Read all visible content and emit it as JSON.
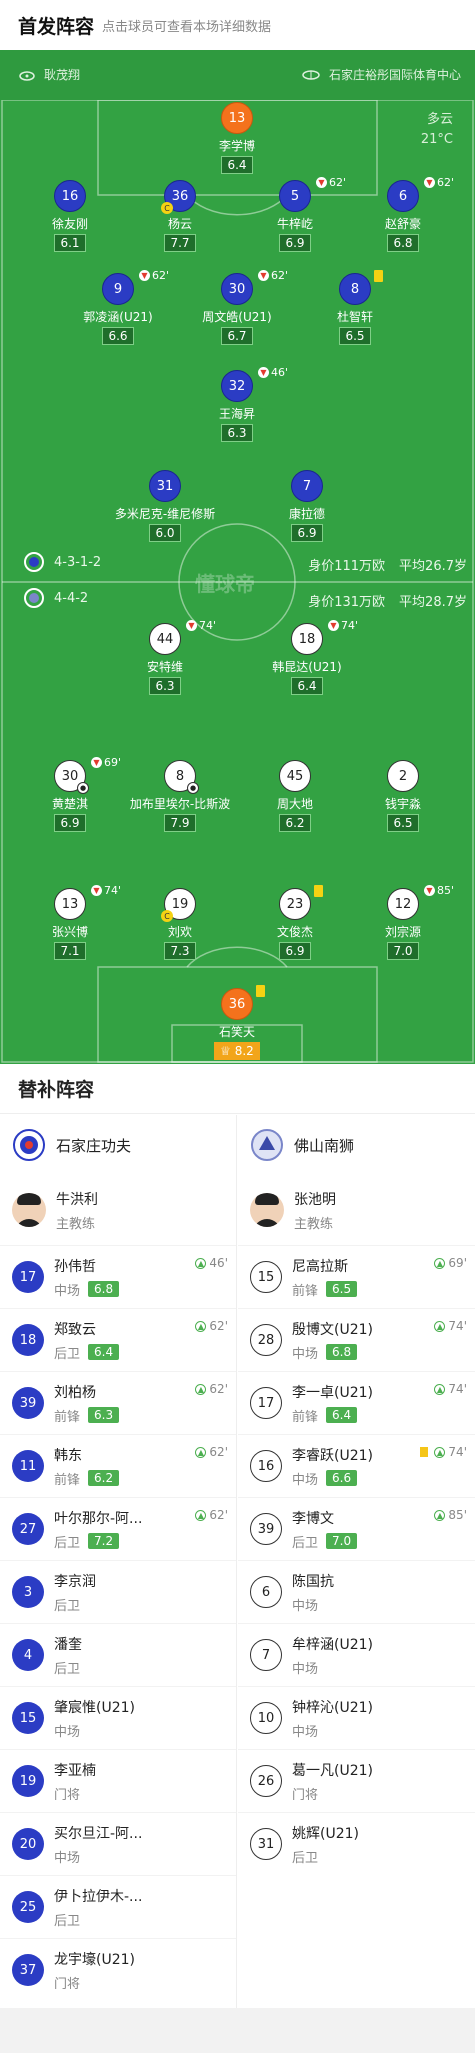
{
  "header": {
    "title": "首发阵容",
    "subtitle": "点击球员可查看本场详细数据"
  },
  "pitch": {
    "referee": "耿茂翔",
    "venue": "石家庄裕彤国际体育中心",
    "weather": "多云",
    "temperature": "21°C",
    "watermark": "懂球帝",
    "home_formation": "4-3-1-2",
    "home_value": "身价111万欧",
    "home_age": "平均26.7岁",
    "away_formation": "4-4-2",
    "away_value": "身价131万欧",
    "away_age": "平均28.7岁"
  },
  "home_players": [
    {
      "num": "13",
      "name": "李学博",
      "rating": "6.4"
    },
    {
      "num": "16",
      "name": "徐友刚",
      "rating": "6.1"
    },
    {
      "num": "36",
      "name": "杨云",
      "rating": "7.7"
    },
    {
      "num": "5",
      "name": "牛梓屹",
      "rating": "6.9",
      "sub": "62'"
    },
    {
      "num": "6",
      "name": "赵舒豪",
      "rating": "6.8",
      "sub": "62'"
    },
    {
      "num": "9",
      "name": "郭凌涵(U21)",
      "rating": "6.6",
      "sub": "62'"
    },
    {
      "num": "30",
      "name": "周文皓(U21)",
      "rating": "6.7",
      "sub": "62'"
    },
    {
      "num": "8",
      "name": "杜智轩",
      "rating": "6.5"
    },
    {
      "num": "32",
      "name": "王海昇",
      "rating": "6.3",
      "sub": "46'"
    },
    {
      "num": "31",
      "name": "多米尼克-维尼修斯",
      "rating": "6.0"
    },
    {
      "num": "7",
      "name": "康拉德",
      "rating": "6.9"
    }
  ],
  "away_players": [
    {
      "num": "44",
      "name": "安特维",
      "rating": "6.3",
      "sub": "74'"
    },
    {
      "num": "18",
      "name": "韩昆达(U21)",
      "rating": "6.4",
      "sub": "74'"
    },
    {
      "num": "30",
      "name": "黄楚淇",
      "rating": "6.9",
      "sub": "69'"
    },
    {
      "num": "8",
      "name": "加布里埃尔-比斯波",
      "rating": "7.9"
    },
    {
      "num": "45",
      "name": "周大地",
      "rating": "6.2"
    },
    {
      "num": "2",
      "name": "钱宇淼",
      "rating": "6.5"
    },
    {
      "num": "13",
      "name": "张兴博",
      "rating": "7.1",
      "sub": "74'"
    },
    {
      "num": "19",
      "name": "刘欢",
      "rating": "7.3"
    },
    {
      "num": "23",
      "name": "文俊杰",
      "rating": "6.9"
    },
    {
      "num": "12",
      "name": "刘宗源",
      "rating": "7.0",
      "sub": "85'"
    },
    {
      "num": "36",
      "name": "石笑天",
      "rating": "8.2"
    }
  ],
  "subs": {
    "title": "替补阵容",
    "home": {
      "team": "石家庄功夫",
      "coach": "牛洪利",
      "coach_role": "主教练",
      "players": [
        {
          "num": "17",
          "name": "孙伟哲",
          "pos": "中场",
          "rating": "6.8",
          "in": "46'"
        },
        {
          "num": "18",
          "name": "郑致云",
          "pos": "后卫",
          "rating": "6.4",
          "in": "62'"
        },
        {
          "num": "39",
          "name": "刘柏杨",
          "pos": "前锋",
          "rating": "6.3",
          "in": "62'"
        },
        {
          "num": "11",
          "name": "韩东",
          "pos": "前锋",
          "rating": "6.2",
          "in": "62'"
        },
        {
          "num": "27",
          "name": "叶尔那尔-阿...",
          "pos": "后卫",
          "rating": "7.2",
          "in": "62'"
        },
        {
          "num": "3",
          "name": "李京润",
          "pos": "后卫"
        },
        {
          "num": "4",
          "name": "潘奎",
          "pos": "后卫"
        },
        {
          "num": "15",
          "name": "肇宸惟(U21)",
          "pos": "中场"
        },
        {
          "num": "19",
          "name": "李亚楠",
          "pos": "门将"
        },
        {
          "num": "20",
          "name": "买尔旦江-阿...",
          "pos": "中场"
        },
        {
          "num": "25",
          "name": "伊卜拉伊木-...",
          "pos": "后卫"
        },
        {
          "num": "37",
          "name": "龙宇壕(U21)",
          "pos": "门将"
        }
      ]
    },
    "away": {
      "team": "佛山南狮",
      "coach": "张池明",
      "coach_role": "主教练",
      "players": [
        {
          "num": "15",
          "name": "尼高拉斯",
          "pos": "前锋",
          "rating": "6.5",
          "in": "69'"
        },
        {
          "num": "28",
          "name": "殷博文(U21)",
          "pos": "中场",
          "rating": "6.8",
          "in": "74'"
        },
        {
          "num": "17",
          "name": "李一卓(U21)",
          "pos": "前锋",
          "rating": "6.4",
          "in": "74'"
        },
        {
          "num": "16",
          "name": "李睿跃(U21)",
          "pos": "中场",
          "rating": "6.6",
          "in": "74'"
        },
        {
          "num": "39",
          "name": "李博文",
          "pos": "后卫",
          "rating": "7.0",
          "in": "85'"
        },
        {
          "num": "6",
          "name": "陈国抗",
          "pos": "中场"
        },
        {
          "num": "7",
          "name": "牟梓涵(U21)",
          "pos": "中场"
        },
        {
          "num": "10",
          "name": "钟梓沁(U21)",
          "pos": "中场"
        },
        {
          "num": "26",
          "name": "葛一凡(U21)",
          "pos": "门将"
        },
        {
          "num": "31",
          "name": "姚辉(U21)",
          "pos": "后卫"
        }
      ]
    }
  },
  "colors": {
    "pitch": "#33a243",
    "home": "#2b3cc4",
    "away": "#ffffff",
    "goalkeeper": "#f4721c",
    "rating_bg": "#4caf50"
  }
}
